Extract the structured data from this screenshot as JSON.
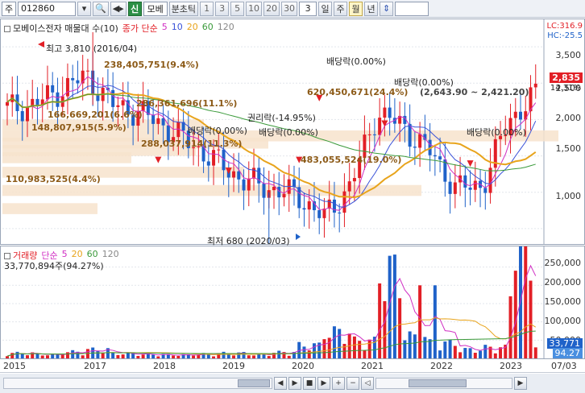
{
  "toolbar": {
    "prefix": "주",
    "code": "012860",
    "signal": "신",
    "name": "모베",
    "tick_mode": "분초틱",
    "periods": [
      "1",
      "3",
      "5",
      "10",
      "20",
      "30"
    ],
    "current": "3",
    "timeframes": [
      "일",
      "주",
      "월",
      "년"
    ],
    "selected_timeframe": "월"
  },
  "price": {
    "legend_title": "모베이스전자 매물대 수(10)",
    "ma_title": "종가 단순",
    "ma_periods": [
      "5",
      "10",
      "20",
      "60",
      "120"
    ],
    "lc": "LC:316.9",
    "hc": "HC:-25.5",
    "last_price": "2,835",
    "last_pct": "14.31%",
    "y_ticks": [
      "3,500",
      "3,000",
      "2,500",
      "2,000",
      "1,500",
      "1,000"
    ],
    "high_label": "최고 3,810 (2016/04)",
    "low_label": "최저 680 (2020/03)",
    "bands": [
      "238,405,751(9.4%)",
      "620,450,671(24.4%)",
      "166,669,201(6.6%)",
      "148,807,915(5.9%)",
      "288,037,914(11.3%)",
      "110,983,525(4.4%)",
      "483,055,524(19.0%)",
      "286,361,696(11.1%)"
    ],
    "price_range": "(2,643.90 ~ 2,421.20)",
    "dividend_labels": [
      "배당락(0.00%)",
      "배당락(0.00%)",
      "배당락(0.00%)",
      "배당락(0.00%)",
      "배당락(0.00%)",
      "권리락(-14.95%)",
      "권리락(0.00%)",
      "배당락(0.00%)"
    ]
  },
  "volume": {
    "legend_title": "거래량",
    "ma_title": "단순",
    "ma_periods": [
      "5",
      "20",
      "60",
      "120"
    ],
    "summary": "33,770,894주(94.27%)",
    "y_ticks": [
      "250,000",
      "200,000",
      "150,000",
      "100,000",
      "50,000"
    ],
    "last_vol": "33,771",
    "last_pct": "94.27"
  },
  "xaxis": {
    "years": [
      "2015",
      "2017",
      "2018",
      "2019",
      "2020",
      "2021",
      "2022",
      "2023"
    ],
    "last": "07/03"
  },
  "colors": {
    "up": "#e21f26",
    "down": "#1f62c9",
    "ma5": "#d02fc3",
    "ma10": "#3a52d8",
    "ma20": "#e8a41c",
    "ma60": "#3a9a3a",
    "ma120": "#888888",
    "band": "#f7e3cc"
  },
  "chart_data": {
    "type": "candlestick",
    "x": [
      "2015/01",
      "2015/07",
      "2016/01",
      "2016/04",
      "2016/07",
      "2017/01",
      "2017/07",
      "2018/01",
      "2018/07",
      "2019/01",
      "2019/07",
      "2020/01",
      "2020/03",
      "2020/07",
      "2021/01",
      "2021/07",
      "2022/01",
      "2022/07",
      "2023/01",
      "2023/05",
      "2023/07"
    ],
    "close": [
      2650,
      2700,
      2900,
      3100,
      2700,
      2600,
      2400,
      2150,
      1900,
      1650,
      1550,
      1450,
      1150,
      1600,
      2600,
      2400,
      2050,
      1550,
      1600,
      2500,
      2835
    ],
    "high": 3810,
    "low": 680,
    "volume": [
      12000,
      9000,
      15000,
      20000,
      11000,
      9000,
      8000,
      10000,
      12000,
      9000,
      14000,
      30000,
      60000,
      40000,
      200000,
      50000,
      35000,
      20000,
      25000,
      230000,
      33771
    ],
    "ylim": [
      800,
      3700
    ]
  }
}
